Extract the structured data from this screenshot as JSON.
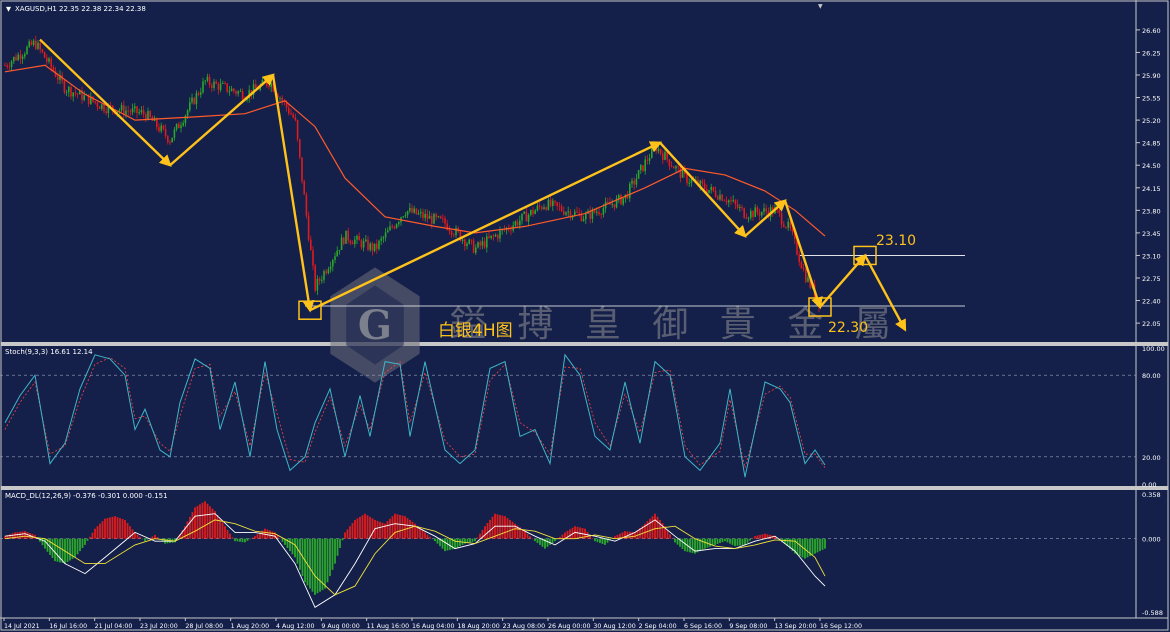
{
  "colors": {
    "background": "#14204a",
    "frame": "#c8c8c8",
    "bull": "#2ba82b",
    "bear": "#e01b1b",
    "ma": "#ff5a2a",
    "arrow": "#ffc21a",
    "stoch_main": "#3fb6c8",
    "stoch_signal": "#ff4040",
    "macd_line": "#ffffff",
    "macd_signal": "#f2e23a",
    "text": "#ffffff"
  },
  "main": {
    "header": "XAGUSD,H1  22.35 22.38 22.34 22.38",
    "watermark": "鎰 搏 皇 御 貴 金 屬",
    "subtitle": "白银4H图",
    "level_high": "23.10",
    "level_low": "22.30",
    "price_ticks": [
      "26.60",
      "26.25",
      "25.90",
      "25.55",
      "25.20",
      "24.85",
      "24.50",
      "24.15",
      "23.80",
      "23.45",
      "23.10",
      "22.75",
      "22.40",
      "22.05"
    ]
  },
  "stoch": {
    "header": "Stoch(9,3,3) 16.61 12.14",
    "ticks": [
      "100.00",
      "80.00",
      "20.00",
      "0.00"
    ]
  },
  "macd": {
    "header": "MACD_DL(12,26,9) -0.376 -0.301 0.000 -0.151",
    "ticks": [
      "0.358",
      "0.000",
      "-0.588"
    ]
  },
  "time_ticks": [
    "14 Jul 2021",
    "16 Jul 16:00",
    "21 Jul 04:00",
    "23 Jul 20:00",
    "28 Jul 08:00",
    "1 Aug 20:00",
    "4 Aug 12:00",
    "9 Aug 00:00",
    "11 Aug 16:00",
    "16 Aug 04:00",
    "18 Aug 20:00",
    "23 Aug 08:00",
    "26 Aug 00:00",
    "30 Aug 12:00",
    "2 Sep 04:00",
    "6 Sep 16:00",
    "9 Sep 08:00",
    "13 Sep 20:00",
    "16 Sep 12:00"
  ],
  "chart_data": {
    "type": "line",
    "symbol": "XAGUSD",
    "timeframe": "H1",
    "ohlc_last": {
      "open": 22.35,
      "high": 22.38,
      "low": 22.34,
      "close": 22.38
    },
    "price_anchors": [
      [
        0,
        26.05
      ],
      [
        30,
        26.4
      ],
      [
        60,
        25.7
      ],
      [
        100,
        25.4
      ],
      [
        140,
        25.3
      ],
      [
        165,
        24.9
      ],
      [
        200,
        25.8
      ],
      [
        240,
        25.6
      ],
      [
        265,
        25.8
      ],
      [
        290,
        25.2
      ],
      [
        310,
        22.6
      ],
      [
        340,
        23.4
      ],
      [
        370,
        23.2
      ],
      [
        400,
        23.8
      ],
      [
        440,
        23.6
      ],
      [
        470,
        23.2
      ],
      [
        500,
        23.5
      ],
      [
        540,
        23.9
      ],
      [
        580,
        23.7
      ],
      [
        620,
        24.0
      ],
      [
        650,
        24.8
      ],
      [
        680,
        24.3
      ],
      [
        720,
        24.0
      ],
      [
        740,
        23.75
      ],
      [
        770,
        23.8
      ],
      [
        785,
        23.5
      ],
      [
        800,
        22.8
      ],
      [
        815,
        22.35
      ]
    ],
    "ma_points": [
      [
        0,
        25.95
      ],
      [
        40,
        26.05
      ],
      [
        80,
        25.6
      ],
      [
        130,
        25.2
      ],
      [
        190,
        25.25
      ],
      [
        240,
        25.3
      ],
      [
        280,
        25.5
      ],
      [
        310,
        25.1
      ],
      [
        340,
        24.3
      ],
      [
        380,
        23.7
      ],
      [
        430,
        23.55
      ],
      [
        470,
        23.45
      ],
      [
        520,
        23.55
      ],
      [
        580,
        23.75
      ],
      [
        640,
        24.15
      ],
      [
        680,
        24.45
      ],
      [
        720,
        24.35
      ],
      [
        760,
        24.1
      ],
      [
        790,
        23.8
      ],
      [
        820,
        23.4
      ]
    ],
    "pattern_points": [
      [
        35,
        26.45
      ],
      [
        165,
        24.5
      ],
      [
        268,
        25.9
      ],
      [
        305,
        22.25
      ],
      [
        655,
        24.85
      ],
      [
        740,
        23.4
      ],
      [
        780,
        23.95
      ],
      [
        815,
        22.3
      ],
      [
        860,
        23.1
      ],
      [
        900,
        21.95
      ]
    ],
    "levels": {
      "high": 23.1,
      "low": 22.3
    },
    "ylim": [
      21.85,
      26.8
    ],
    "stoch": {
      "main": [
        [
          0,
          45
        ],
        [
          15,
          65
        ],
        [
          30,
          80
        ],
        [
          45,
          15
        ],
        [
          60,
          30
        ],
        [
          75,
          70
        ],
        [
          90,
          95
        ],
        [
          105,
          92
        ],
        [
          120,
          80
        ],
        [
          130,
          40
        ],
        [
          140,
          55
        ],
        [
          155,
          25
        ],
        [
          165,
          20
        ],
        [
          175,
          60
        ],
        [
          190,
          92
        ],
        [
          205,
          85
        ],
        [
          215,
          40
        ],
        [
          230,
          75
        ],
        [
          245,
          20
        ],
        [
          260,
          90
        ],
        [
          272,
          40
        ],
        [
          285,
          10
        ],
        [
          300,
          20
        ],
        [
          310,
          45
        ],
        [
          325,
          70
        ],
        [
          340,
          20
        ],
        [
          355,
          65
        ],
        [
          365,
          35
        ],
        [
          380,
          90
        ],
        [
          395,
          88
        ],
        [
          405,
          35
        ],
        [
          420,
          90
        ],
        [
          440,
          25
        ],
        [
          455,
          15
        ],
        [
          470,
          25
        ],
        [
          485,
          85
        ],
        [
          500,
          90
        ],
        [
          515,
          35
        ],
        [
          530,
          40
        ],
        [
          545,
          15
        ],
        [
          560,
          95
        ],
        [
          575,
          80
        ],
        [
          590,
          35
        ],
        [
          605,
          25
        ],
        [
          620,
          75
        ],
        [
          635,
          30
        ],
        [
          650,
          90
        ],
        [
          665,
          80
        ],
        [
          680,
          20
        ],
        [
          695,
          10
        ],
        [
          715,
          30
        ],
        [
          725,
          70
        ],
        [
          740,
          5
        ],
        [
          760,
          75
        ],
        [
          775,
          70
        ],
        [
          785,
          60
        ],
        [
          800,
          15
        ],
        [
          810,
          25
        ],
        [
          820,
          14
        ]
      ],
      "signal": [
        [
          0,
          40
        ],
        [
          15,
          60
        ],
        [
          30,
          75
        ],
        [
          45,
          22
        ],
        [
          60,
          28
        ],
        [
          75,
          62
        ],
        [
          90,
          88
        ],
        [
          105,
          93
        ],
        [
          120,
          85
        ],
        [
          130,
          48
        ],
        [
          140,
          50
        ],
        [
          155,
          30
        ],
        [
          165,
          24
        ],
        [
          175,
          50
        ],
        [
          190,
          85
        ],
        [
          205,
          88
        ],
        [
          215,
          50
        ],
        [
          230,
          68
        ],
        [
          245,
          28
        ],
        [
          260,
          82
        ],
        [
          272,
          52
        ],
        [
          285,
          18
        ],
        [
          300,
          16
        ],
        [
          310,
          38
        ],
        [
          325,
          64
        ],
        [
          340,
          28
        ],
        [
          355,
          58
        ],
        [
          365,
          40
        ],
        [
          380,
          82
        ],
        [
          395,
          90
        ],
        [
          405,
          45
        ],
        [
          420,
          82
        ],
        [
          440,
          32
        ],
        [
          455,
          20
        ],
        [
          470,
          22
        ],
        [
          485,
          76
        ],
        [
          500,
          88
        ],
        [
          515,
          45
        ],
        [
          530,
          38
        ],
        [
          545,
          22
        ],
        [
          560,
          86
        ],
        [
          575,
          85
        ],
        [
          590,
          45
        ],
        [
          605,
          28
        ],
        [
          620,
          66
        ],
        [
          635,
          38
        ],
        [
          650,
          82
        ],
        [
          665,
          84
        ],
        [
          680,
          28
        ],
        [
          695,
          14
        ],
        [
          715,
          24
        ],
        [
          725,
          62
        ],
        [
          740,
          12
        ],
        [
          760,
          66
        ],
        [
          775,
          72
        ],
        [
          785,
          64
        ],
        [
          800,
          22
        ],
        [
          810,
          22
        ],
        [
          820,
          12
        ]
      ],
      "ylim": [
        0,
        100
      ],
      "levels": [
        80,
        20
      ],
      "last": {
        "main": 16.61,
        "signal": 12.14
      }
    },
    "macd": {
      "histogram": [
        [
          0,
          0.02
        ],
        [
          10,
          0.05
        ],
        [
          20,
          0.06
        ],
        [
          30,
          0.03
        ],
        [
          40,
          -0.08
        ],
        [
          50,
          -0.18
        ],
        [
          60,
          -0.2
        ],
        [
          70,
          -0.15
        ],
        [
          80,
          -0.05
        ],
        [
          90,
          0.08
        ],
        [
          100,
          0.16
        ],
        [
          110,
          0.18
        ],
        [
          120,
          0.15
        ],
        [
          130,
          0.05
        ],
        [
          140,
          -0.02
        ],
        [
          150,
          0.03
        ],
        [
          160,
          -0.04
        ],
        [
          170,
          -0.03
        ],
        [
          180,
          0.1
        ],
        [
          190,
          0.25
        ],
        [
          200,
          0.3
        ],
        [
          210,
          0.22
        ],
        [
          220,
          0.1
        ],
        [
          230,
          -0.02
        ],
        [
          240,
          -0.03
        ],
        [
          250,
          0.02
        ],
        [
          260,
          0.08
        ],
        [
          270,
          0.05
        ],
        [
          280,
          -0.05
        ],
        [
          290,
          -0.15
        ],
        [
          300,
          -0.35
        ],
        [
          310,
          -0.45
        ],
        [
          320,
          -0.4
        ],
        [
          330,
          -0.2
        ],
        [
          340,
          0.05
        ],
        [
          350,
          0.15
        ],
        [
          360,
          0.2
        ],
        [
          370,
          0.15
        ],
        [
          380,
          0.12
        ],
        [
          390,
          0.2
        ],
        [
          400,
          0.18
        ],
        [
          410,
          0.12
        ],
        [
          420,
          0.05
        ],
        [
          430,
          -0.02
        ],
        [
          440,
          -0.1
        ],
        [
          450,
          -0.08
        ],
        [
          460,
          -0.04
        ],
        [
          470,
          -0.02
        ],
        [
          480,
          0.1
        ],
        [
          490,
          0.2
        ],
        [
          500,
          0.18
        ],
        [
          510,
          0.12
        ],
        [
          520,
          0.06
        ],
        [
          530,
          -0.02
        ],
        [
          540,
          -0.08
        ],
        [
          550,
          -0.02
        ],
        [
          560,
          0.05
        ],
        [
          570,
          0.1
        ],
        [
          580,
          0.08
        ],
        [
          590,
          -0.02
        ],
        [
          600,
          -0.05
        ],
        [
          610,
          0.02
        ],
        [
          620,
          0.06
        ],
        [
          630,
          0.05
        ],
        [
          640,
          0.12
        ],
        [
          650,
          0.2
        ],
        [
          660,
          0.1
        ],
        [
          670,
          -0.03
        ],
        [
          680,
          -0.1
        ],
        [
          690,
          -0.12
        ],
        [
          700,
          -0.08
        ],
        [
          710,
          -0.05
        ],
        [
          720,
          -0.02
        ],
        [
          730,
          -0.06
        ],
        [
          740,
          -0.05
        ],
        [
          750,
          0.02
        ],
        [
          760,
          0.04
        ],
        [
          770,
          0.02
        ],
        [
          780,
          -0.04
        ],
        [
          790,
          -0.12
        ],
        [
          800,
          -0.16
        ],
        [
          810,
          -0.12
        ],
        [
          820,
          -0.08
        ]
      ],
      "line": [
        [
          0,
          0.02
        ],
        [
          20,
          0.04
        ],
        [
          40,
          -0.02
        ],
        [
          60,
          -0.2
        ],
        [
          80,
          -0.28
        ],
        [
          100,
          -0.15
        ],
        [
          130,
          0.05
        ],
        [
          150,
          -0.02
        ],
        [
          170,
          -0.02
        ],
        [
          190,
          0.18
        ],
        [
          210,
          0.2
        ],
        [
          230,
          0.05
        ],
        [
          250,
          0.05
        ],
        [
          270,
          0.02
        ],
        [
          290,
          -0.2
        ],
        [
          310,
          -0.55
        ],
        [
          330,
          -0.45
        ],
        [
          350,
          -0.2
        ],
        [
          370,
          0.08
        ],
        [
          390,
          0.12
        ],
        [
          410,
          0.1
        ],
        [
          430,
          0.02
        ],
        [
          450,
          -0.08
        ],
        [
          470,
          -0.04
        ],
        [
          490,
          0.1
        ],
        [
          510,
          0.1
        ],
        [
          530,
          0.02
        ],
        [
          550,
          -0.05
        ],
        [
          570,
          0.05
        ],
        [
          590,
          0.02
        ],
        [
          610,
          -0.02
        ],
        [
          630,
          0.05
        ],
        [
          650,
          0.15
        ],
        [
          670,
          0.02
        ],
        [
          690,
          -0.1
        ],
        [
          710,
          -0.08
        ],
        [
          730,
          -0.08
        ],
        [
          750,
          -0.02
        ],
        [
          770,
          0.02
        ],
        [
          790,
          -0.1
        ],
        [
          810,
          -0.3
        ],
        [
          820,
          -0.38
        ]
      ],
      "signal": [
        [
          0,
          0.0
        ],
        [
          20,
          0.02
        ],
        [
          40,
          0.0
        ],
        [
          60,
          -0.1
        ],
        [
          80,
          -0.2
        ],
        [
          100,
          -0.2
        ],
        [
          130,
          -0.05
        ],
        [
          150,
          0.0
        ],
        [
          170,
          -0.02
        ],
        [
          190,
          0.06
        ],
        [
          210,
          0.15
        ],
        [
          230,
          0.12
        ],
        [
          250,
          0.06
        ],
        [
          270,
          0.04
        ],
        [
          290,
          -0.05
        ],
        [
          310,
          -0.3
        ],
        [
          330,
          -0.45
        ],
        [
          350,
          -0.38
        ],
        [
          370,
          -0.12
        ],
        [
          390,
          0.05
        ],
        [
          410,
          0.1
        ],
        [
          430,
          0.06
        ],
        [
          450,
          -0.02
        ],
        [
          470,
          -0.04
        ],
        [
          490,
          0.02
        ],
        [
          510,
          0.08
        ],
        [
          530,
          0.06
        ],
        [
          550,
          0.0
        ],
        [
          570,
          0.0
        ],
        [
          590,
          0.03
        ],
        [
          610,
          0.0
        ],
        [
          630,
          0.02
        ],
        [
          650,
          0.08
        ],
        [
          670,
          0.1
        ],
        [
          690,
          0.0
        ],
        [
          710,
          -0.06
        ],
        [
          730,
          -0.08
        ],
        [
          750,
          -0.05
        ],
        [
          770,
          -0.01
        ],
        [
          790,
          -0.02
        ],
        [
          810,
          -0.15
        ],
        [
          820,
          -0.3
        ]
      ],
      "ylim": [
        -0.588,
        0.358
      ],
      "last": {
        "macd": -0.376,
        "signal": -0.301,
        "zero": 0.0,
        "hist": -0.151
      }
    }
  }
}
